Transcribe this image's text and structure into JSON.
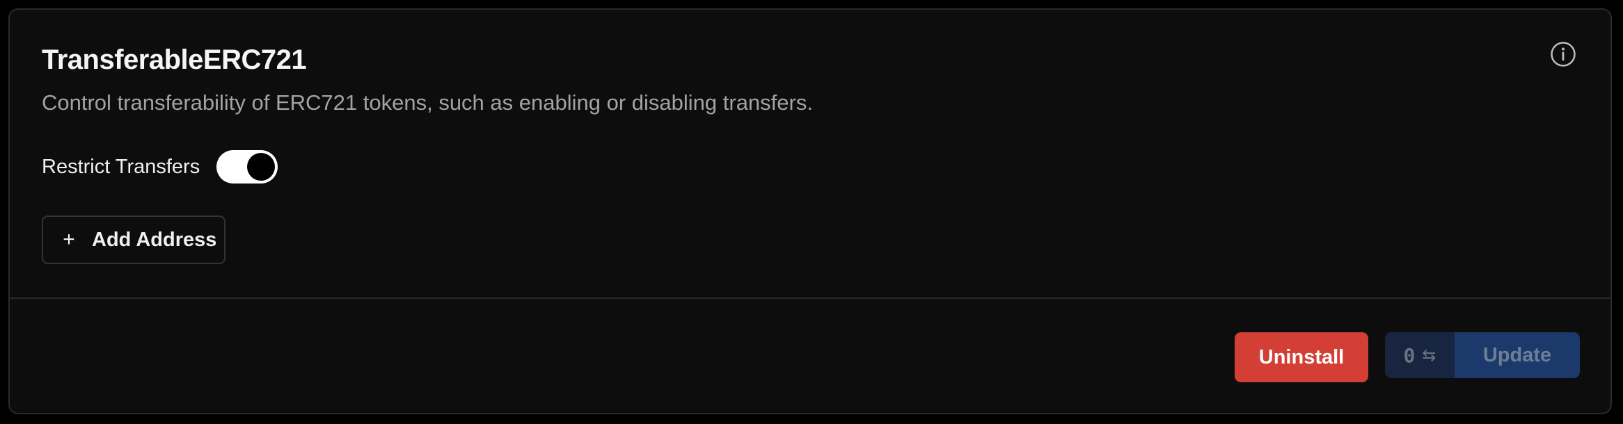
{
  "module": {
    "title": "TransferableERC721",
    "description": "Control transferability of ERC721 tokens, such as enabling or disabling transfers."
  },
  "settings": {
    "restrict_transfers_label": "Restrict Transfers",
    "restrict_transfers_enabled": true
  },
  "actions": {
    "add_address_label": "Add Address",
    "uninstall_label": "Uninstall",
    "tx_count": "0",
    "update_label": "Update"
  },
  "icons": {
    "info": "info-icon",
    "plus": "plus-icon",
    "swap": "swap-arrows-icon"
  },
  "colors": {
    "background": "#0d0d0d",
    "uninstall": "#d43f35",
    "update": "#1b3a6b",
    "tx_count": "#172540"
  }
}
